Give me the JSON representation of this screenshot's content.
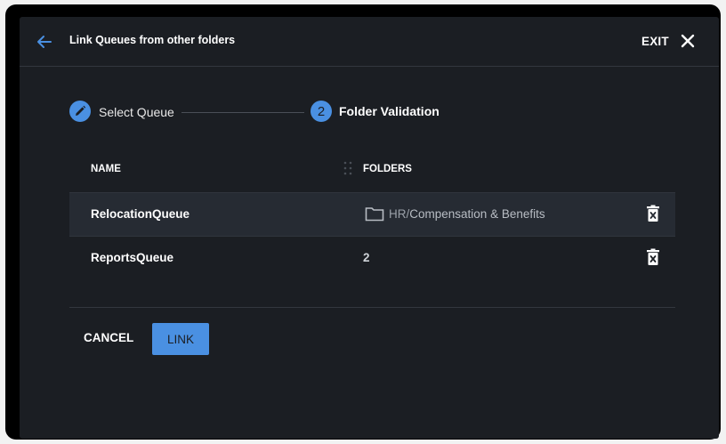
{
  "dialog": {
    "title": "Link Queues from other folders",
    "exit_label": "EXIT"
  },
  "stepper": {
    "steps": [
      {
        "label": "Select Queue",
        "icon": "pencil-icon"
      },
      {
        "number": "2",
        "label": "Folder Validation"
      }
    ]
  },
  "table": {
    "columns": [
      "NAME",
      "FOLDERS"
    ],
    "rows": [
      {
        "name": "RelocationQueue",
        "folder_parent": "HR",
        "folder_sep": "/",
        "folder_name": "Compensation & Benefits"
      },
      {
        "name": "ReportsQueue",
        "folder_count": "2"
      }
    ]
  },
  "actions": {
    "cancel_label": "CANCEL",
    "link_label": "LINK"
  },
  "colors": {
    "accent": "#4a90e2",
    "background": "#1b1e23",
    "selected_row": "#262b33"
  }
}
